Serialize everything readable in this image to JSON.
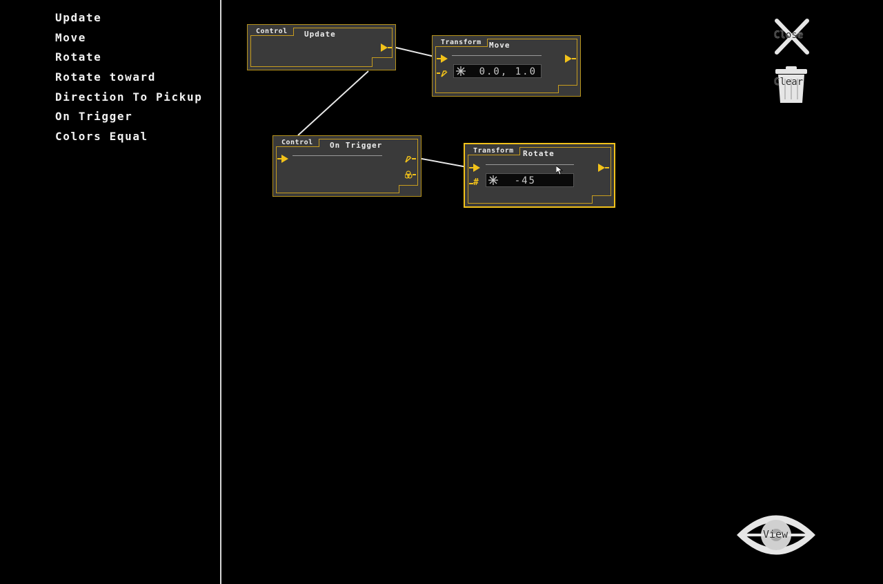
{
  "sidebar": {
    "items": [
      {
        "label": "Update"
      },
      {
        "label": "Move"
      },
      {
        "label": "Rotate"
      },
      {
        "label": "Rotate toward"
      },
      {
        "label": "Direction To Pickup"
      },
      {
        "label": "On Trigger"
      },
      {
        "label": "Colors Equal"
      }
    ]
  },
  "nodes": {
    "update": {
      "category": "Control",
      "title": "Update"
    },
    "move": {
      "category": "Transform",
      "title": "Move",
      "value": "0.0, 1.0"
    },
    "on_trigger": {
      "category": "Control",
      "title": "On Trigger"
    },
    "rotate": {
      "category": "Transform",
      "title": "Rotate",
      "value": "-45",
      "input_symbol": "#"
    }
  },
  "toolbar": {
    "close_label": "Close",
    "clear_label": "Clear",
    "view_label": "View"
  },
  "colors": {
    "accent": "#f2c21a",
    "node_bg": "#3a3a3a",
    "wire": "#e8e8e8"
  }
}
